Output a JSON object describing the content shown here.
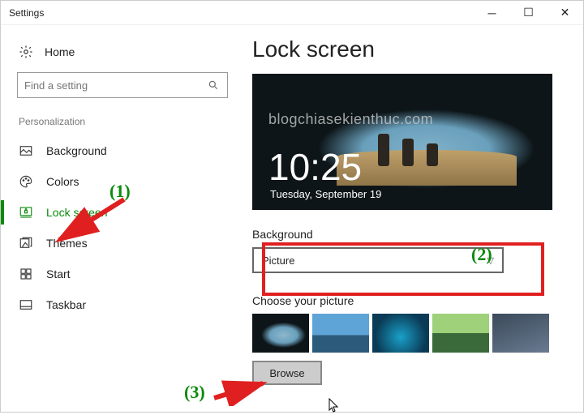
{
  "window": {
    "title": "Settings"
  },
  "sidebar": {
    "home": "Home",
    "search_placeholder": "Find a setting",
    "category": "Personalization",
    "items": [
      {
        "label": "Background"
      },
      {
        "label": "Colors"
      },
      {
        "label": "Lock screen"
      },
      {
        "label": "Themes"
      },
      {
        "label": "Start"
      },
      {
        "label": "Taskbar"
      }
    ]
  },
  "main": {
    "heading": "Lock screen",
    "watermark": "blogchiasekienthuc.com",
    "clock": "10:25",
    "date": "Tuesday, September 19",
    "bg_label": "Background",
    "bg_value": "Picture",
    "choose_label": "Choose your picture",
    "browse_label": "Browse"
  },
  "annotations": {
    "a1": "(1)",
    "a2": "(2)",
    "a3": "(3)"
  }
}
